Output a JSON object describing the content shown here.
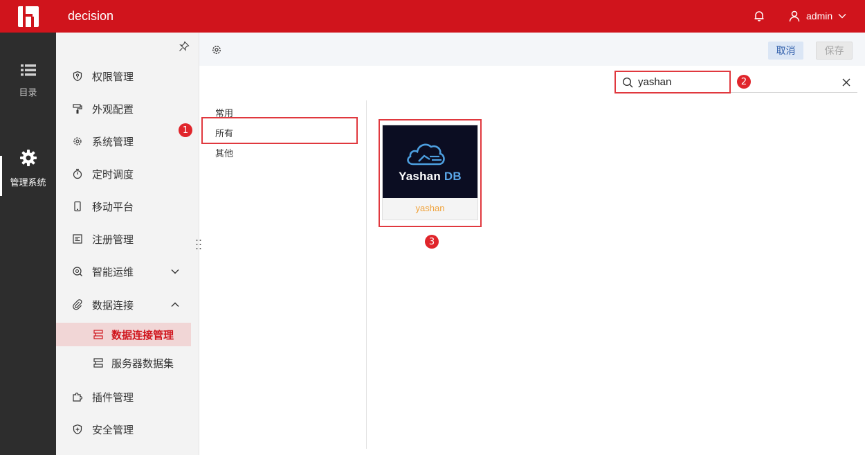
{
  "header": {
    "title": "decision",
    "user": "admin"
  },
  "rail": {
    "items": [
      {
        "label": "目录",
        "icon": "list-icon"
      },
      {
        "label": "管理系统",
        "icon": "gear-icon"
      }
    ]
  },
  "menu": {
    "items": [
      {
        "label": "权限管理",
        "icon": "shield-key-icon"
      },
      {
        "label": "外观配置",
        "icon": "paint-roller-icon"
      },
      {
        "label": "系统管理",
        "icon": "cog-icon"
      },
      {
        "label": "定时调度",
        "icon": "stopwatch-icon"
      },
      {
        "label": "移动平台",
        "icon": "mobile-icon"
      },
      {
        "label": "注册管理",
        "icon": "register-icon"
      },
      {
        "label": "智能运维",
        "icon": "ops-icon"
      },
      {
        "label": "数据连接",
        "icon": "paperclip-icon"
      },
      {
        "label": "插件管理",
        "icon": "puzzle-icon"
      },
      {
        "label": "安全管理",
        "icon": "security-icon"
      }
    ],
    "subitems": [
      {
        "label": "数据连接管理",
        "icon": "db-conn-icon",
        "selected": true
      },
      {
        "label": "服务器数据集",
        "icon": "dataset-icon",
        "selected": false
      }
    ]
  },
  "toolbar": {
    "cancel_label": "取消",
    "save_label": "保存"
  },
  "search": {
    "value": "yashan"
  },
  "categories": [
    "常用",
    "所有",
    "其他"
  ],
  "card": {
    "brand_main": "Yashan",
    "brand_suffix": "DB",
    "label": "yashan"
  },
  "annotations": [
    "1",
    "2",
    "3"
  ],
  "colors": {
    "brand_red": "#d0141c",
    "rail_bg": "#2d2d2d",
    "menu_bg": "#f3f3f3",
    "selected_bg": "#f1d6d6",
    "highlight": "#e0383e",
    "card_label": "#f0a23a"
  }
}
